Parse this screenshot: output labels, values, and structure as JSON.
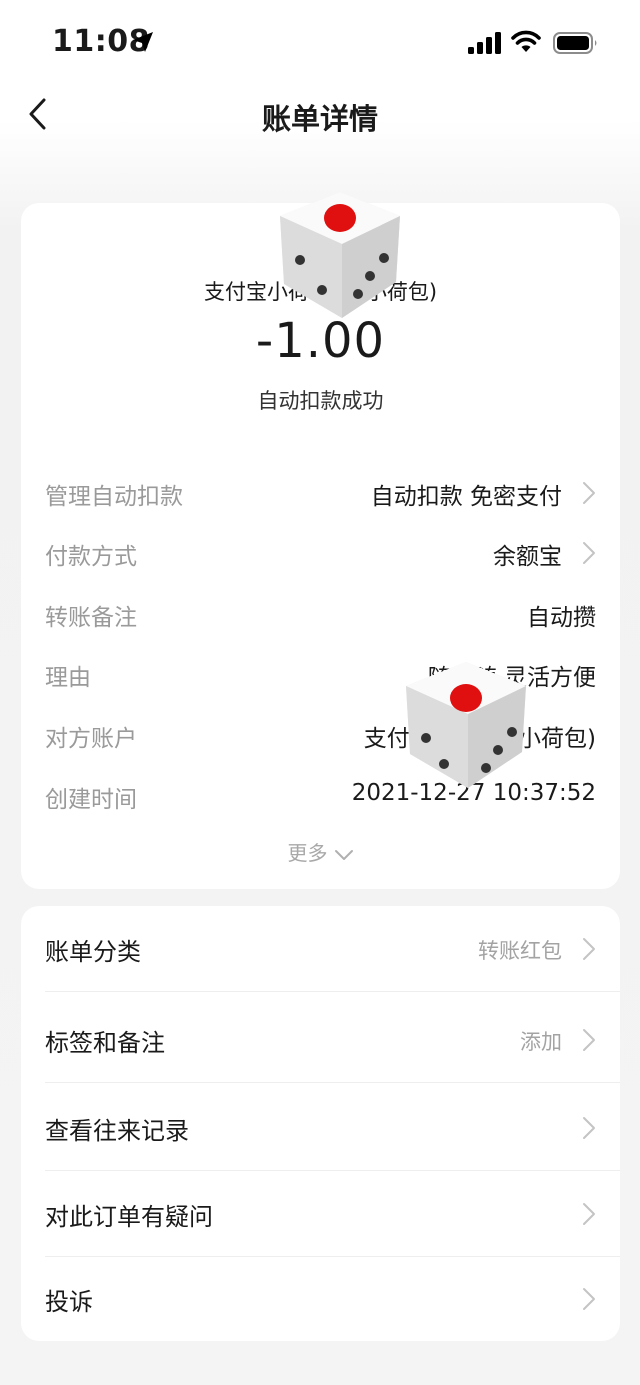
{
  "status_bar": {
    "time": "11:08",
    "icons": [
      "location-arrow-icon",
      "cellular-signal-icon",
      "wifi-icon",
      "battery-icon"
    ]
  },
  "nav": {
    "title": "账单详情",
    "back_icon": "chevron-left-icon"
  },
  "summary": {
    "merchant": "支付宝小荷包(    的小荷包)",
    "amount": "-1.00",
    "status": "自动扣款成功"
  },
  "details": [
    {
      "label": "管理自动扣款",
      "value": "自动扣款 免密支付",
      "arrow": true
    },
    {
      "label": "付款方式",
      "value": "余额宝",
      "arrow": true
    },
    {
      "label": "转账备注",
      "value": "自动攒",
      "arrow": false
    },
    {
      "label": "理由",
      "value": "随用随      灵活方便",
      "arrow": false
    },
    {
      "label": "对方账户",
      "value": "支付宝小荷包(          小荷包)",
      "arrow": false
    },
    {
      "label": "创建时间",
      "value": "2021-12-27 10:37:52",
      "arrow": false
    }
  ],
  "more": {
    "label": "更多"
  },
  "menu": [
    {
      "label": "账单分类",
      "value": "转账红包"
    },
    {
      "label": "标签和备注",
      "value": "添加"
    },
    {
      "label": "查看往来记录",
      "value": ""
    },
    {
      "label": "对此订单有疑问",
      "value": ""
    },
    {
      "label": "投诉",
      "value": ""
    }
  ],
  "colors": {
    "background": "#f4f4f4",
    "card": "#ffffff",
    "label_gray": "#9a9a9a",
    "dice_pip": "#e01010"
  }
}
